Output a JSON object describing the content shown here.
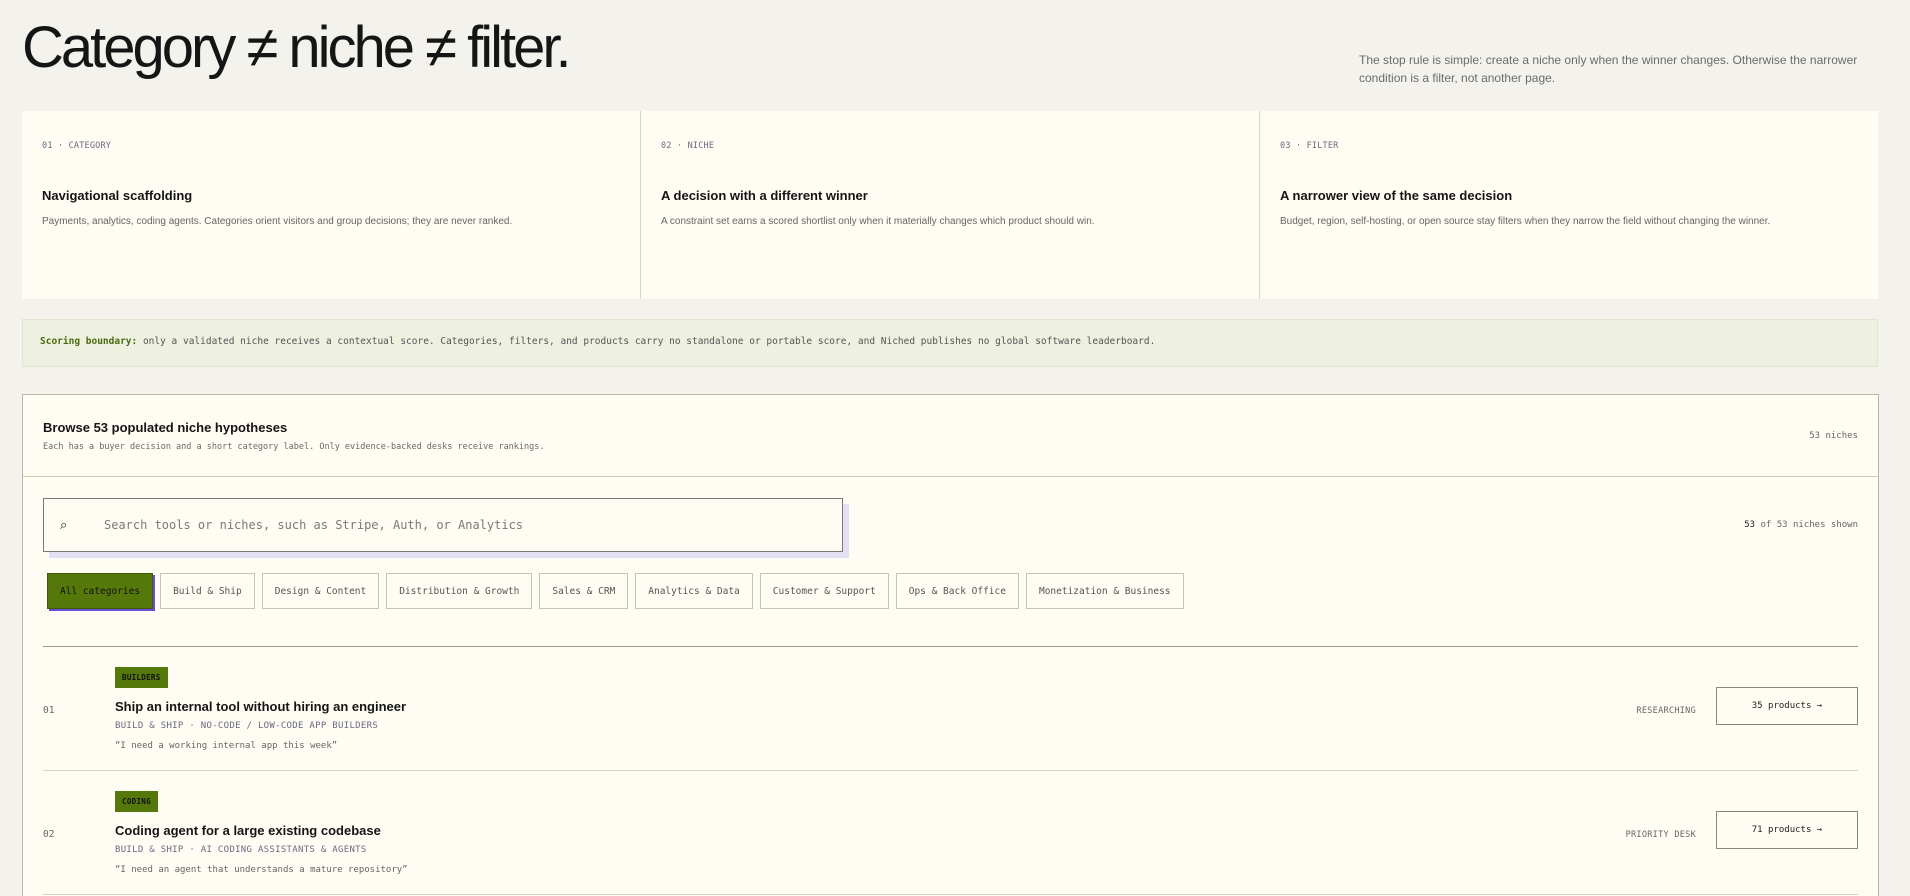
{
  "hero": {
    "title": "Category ≠ niche ≠ filter.",
    "note": "The stop rule is simple: create a niche only when the winner changes. Otherwise the narrower condition is a filter, not another page."
  },
  "concepts": [
    {
      "kicker": "01 · CATEGORY",
      "title": "Navigational scaffolding",
      "body": "Payments, analytics, coding agents. Categories orient visitors and group decisions; they are never ranked."
    },
    {
      "kicker": "02 · NICHE",
      "title": "A decision with a different winner",
      "body": "A constraint set earns a scored shortlist only when it materially changes which product should win."
    },
    {
      "kicker": "03 · FILTER",
      "title": "A narrower view of the same decision",
      "body": "Budget, region, self-hosting, or open source stay filters when they narrow the field without changing the winner."
    }
  ],
  "boundary": {
    "label": "Scoring boundary:",
    "text": " only a validated niche receives a contextual score. Categories, filters, and products carry no standalone or portable score, and Niched publishes no global software leaderboard."
  },
  "panel": {
    "title": "Browse 53 populated niche hypotheses",
    "subtitle": "Each has a buyer decision and a short category label. Only evidence-backed desks receive rankings.",
    "count": "53 niches",
    "search_placeholder": "Search tools or niches, such as Stripe, Auth, or Analytics",
    "search_icon": "⌕",
    "shown_num": "53",
    "shown_rest": " of 53 niches shown",
    "categories": [
      "All categories",
      "Build & Ship",
      "Design & Content",
      "Distribution & Growth",
      "Sales & CRM",
      "Analytics & Data",
      "Customer & Support",
      "Ops & Back Office",
      "Monetization & Business"
    ],
    "active_category": "All categories"
  },
  "niches": [
    {
      "num": "01",
      "tag": "BUILDERS",
      "title": "Ship an internal tool without hiring an engineer",
      "meta": "BUILD & SHIP · NO-CODE / LOW-CODE APP BUILDERS",
      "quote": "“I need a working internal app this week”",
      "status": "RESEARCHING",
      "button": "35 products →"
    },
    {
      "num": "02",
      "tag": "CODING",
      "title": "Coding agent for a large existing codebase",
      "meta": "BUILD & SHIP · AI CODING ASSISTANTS & AGENTS",
      "quote": "“I need an agent that understands a mature repository”",
      "status": "PRIORITY DESK",
      "button": "71 products →"
    }
  ],
  "colors": {
    "accent": "#55780a",
    "background": "#f3f2ec",
    "card": "#fefcf3",
    "shadow": "#6a4fd6"
  }
}
